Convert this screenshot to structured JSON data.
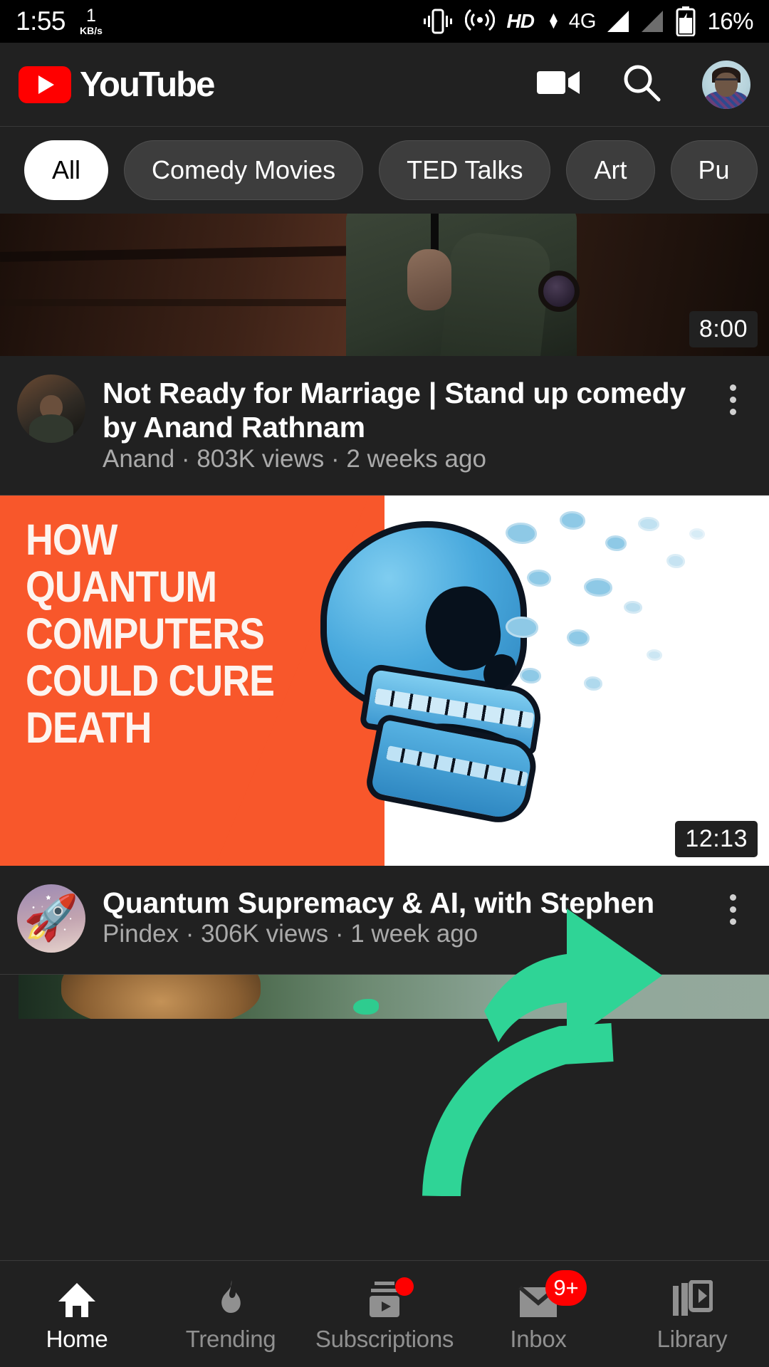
{
  "status_bar": {
    "time": "1:55",
    "network_speed_value": "1",
    "network_speed_unit": "KB/s",
    "icons": [
      "vibrate-icon",
      "hotspot-icon"
    ],
    "hd_label": "HD",
    "network_type": "4G",
    "signal_bars": [
      "signal-strong-icon",
      "signal-weak-icon"
    ],
    "battery_icon": "battery-charging-icon",
    "battery_percent": "16%"
  },
  "header": {
    "logo_text": "YouTube",
    "logo_icon": "youtube-play-icon",
    "actions": [
      {
        "name": "camera-icon",
        "label": "Upload video"
      },
      {
        "name": "search-icon",
        "label": "Search"
      },
      {
        "name": "account-avatar",
        "label": "Account"
      }
    ]
  },
  "chips": {
    "items": [
      {
        "label": "All",
        "active": true
      },
      {
        "label": "Comedy Movies",
        "active": false
      },
      {
        "label": "TED Talks",
        "active": false
      },
      {
        "label": "Art",
        "active": false
      },
      {
        "label": "Pu",
        "active": false
      }
    ]
  },
  "feed": {
    "videos": [
      {
        "title": "Not Ready for Marriage | Stand up comedy by Anand Rathnam",
        "channel": "Anand",
        "views": "803K views",
        "age": "2 weeks ago",
        "meta_line": "Anand · 803K views · 2 weeks ago",
        "duration": "8:00",
        "thumbnail_alt": "stand-up comedian holding microphone on stage",
        "avatar_alt": "comedian channel avatar"
      },
      {
        "title": "Quantum Supremacy & AI, with Stephen",
        "channel": "Pindex",
        "views": "306K views",
        "age": "1 week ago",
        "meta_line": "Pindex · 306K views · 1 week ago",
        "duration": "12:13",
        "thumbnail_alt": "HOW QUANTUM COMPUTERS COULD CURE DEATH with blue skull",
        "thumbnail_text": [
          "HOW",
          "QUANTUM",
          "COMPUTERS",
          "COULD CURE",
          "DEATH"
        ],
        "avatar_alt": "rocket emoji channel avatar"
      },
      {
        "title": "",
        "thumbnail_alt": "partially visible next video thumbnail"
      }
    ]
  },
  "annotation": {
    "arrow_color": "#2fd496",
    "points_to": "overflow-menu-button of second video"
  },
  "bottom_nav": {
    "items": [
      {
        "label": "Home",
        "icon": "home-icon",
        "active": true,
        "badge": ""
      },
      {
        "label": "Trending",
        "icon": "flame-icon",
        "active": false,
        "badge": ""
      },
      {
        "label": "Subscriptions",
        "icon": "subscriptions-icon",
        "active": false,
        "badge": "dot"
      },
      {
        "label": "Inbox",
        "icon": "mail-icon",
        "active": false,
        "badge": "9+"
      },
      {
        "label": "Library",
        "icon": "library-icon",
        "active": false,
        "badge": ""
      }
    ]
  },
  "colors": {
    "background": "#212121",
    "brand_red": "#ff0000",
    "secondary_text": "#aaaaaa",
    "chip_bg": "#3d3d3d",
    "thumbnail_orange": "#f8572b",
    "skull_blue": "#49a9dd",
    "arrow_green": "#2fd496"
  }
}
